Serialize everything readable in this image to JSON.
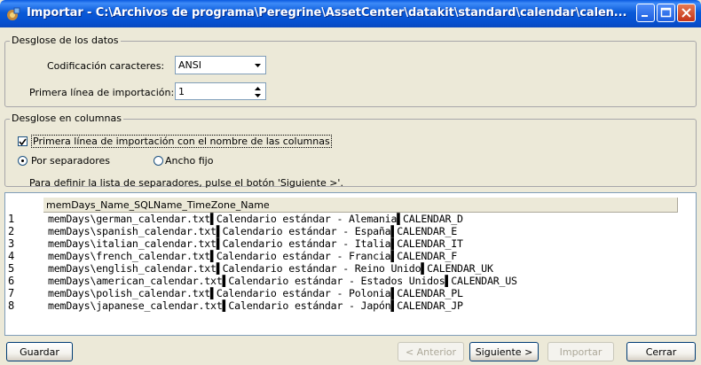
{
  "window": {
    "title": "Importar - C:\\Archivos de programa\\Peregrine\\AssetCenter\\datakit\\standard\\calendar\\calen...",
    "icon": "app-icon"
  },
  "data_group": {
    "legend": "Desglose de los datos",
    "encoding_label": "Codificación caracteres:",
    "encoding_value": "ANSI",
    "first_line_label": "Primera línea de importación:",
    "first_line_value": "1"
  },
  "columns_group": {
    "legend": "Desglose en columnas",
    "header_checkbox_label": "Primera línea de importación con el nombre de las columnas",
    "header_checkbox_checked": true,
    "radio_separators_label": "Por separadores",
    "radio_fixed_label": "Ancho fijo",
    "selected_mode": "separators",
    "instruction": "Para definir la lista de separadores, pulse el botón 'Siguiente >'."
  },
  "preview": {
    "column_header": "memDays_Name_SQLName_TimeZone_Name",
    "rows": [
      {
        "num": "1",
        "text": "memDays\\german_calendar.txt▌Calendario estándar - Alemania▌CALENDAR_D"
      },
      {
        "num": "2",
        "text": "memDays\\spanish_calendar.txt▌Calendario estándar - España▌CALENDAR_E"
      },
      {
        "num": "3",
        "text": "memDays\\italian_calendar.txt▌Calendario estándar - Italia▌CALENDAR_IT"
      },
      {
        "num": "4",
        "text": "memDays\\french_calendar.txt▌Calendario estándar - Francia▌CALENDAR_F"
      },
      {
        "num": "5",
        "text": "memDays\\english_calendar.txt▌Calendario estándar - Reino Unido▌CALENDAR_UK"
      },
      {
        "num": "6",
        "text": "memDays\\american_calendar.txt▌Calendario estándar - Estados Unidos▌CALENDAR_US"
      },
      {
        "num": "7",
        "text": "memDays\\polish_calendar.txt▌Calendario estándar - Polonia▌CALENDAR_PL"
      },
      {
        "num": "8",
        "text": "memDays\\japanese_calendar.txt▌Calendario estándar - Japón▌CALENDAR_JP"
      }
    ]
  },
  "buttons": {
    "save": "Guardar",
    "previous": "< Anterior",
    "next": "Siguiente >",
    "import": "Importar",
    "close": "Cerrar"
  },
  "colors": {
    "titlebar": "#0a5ae0",
    "dialog_bg": "#ece9d8",
    "close_button": "#c4341a"
  }
}
